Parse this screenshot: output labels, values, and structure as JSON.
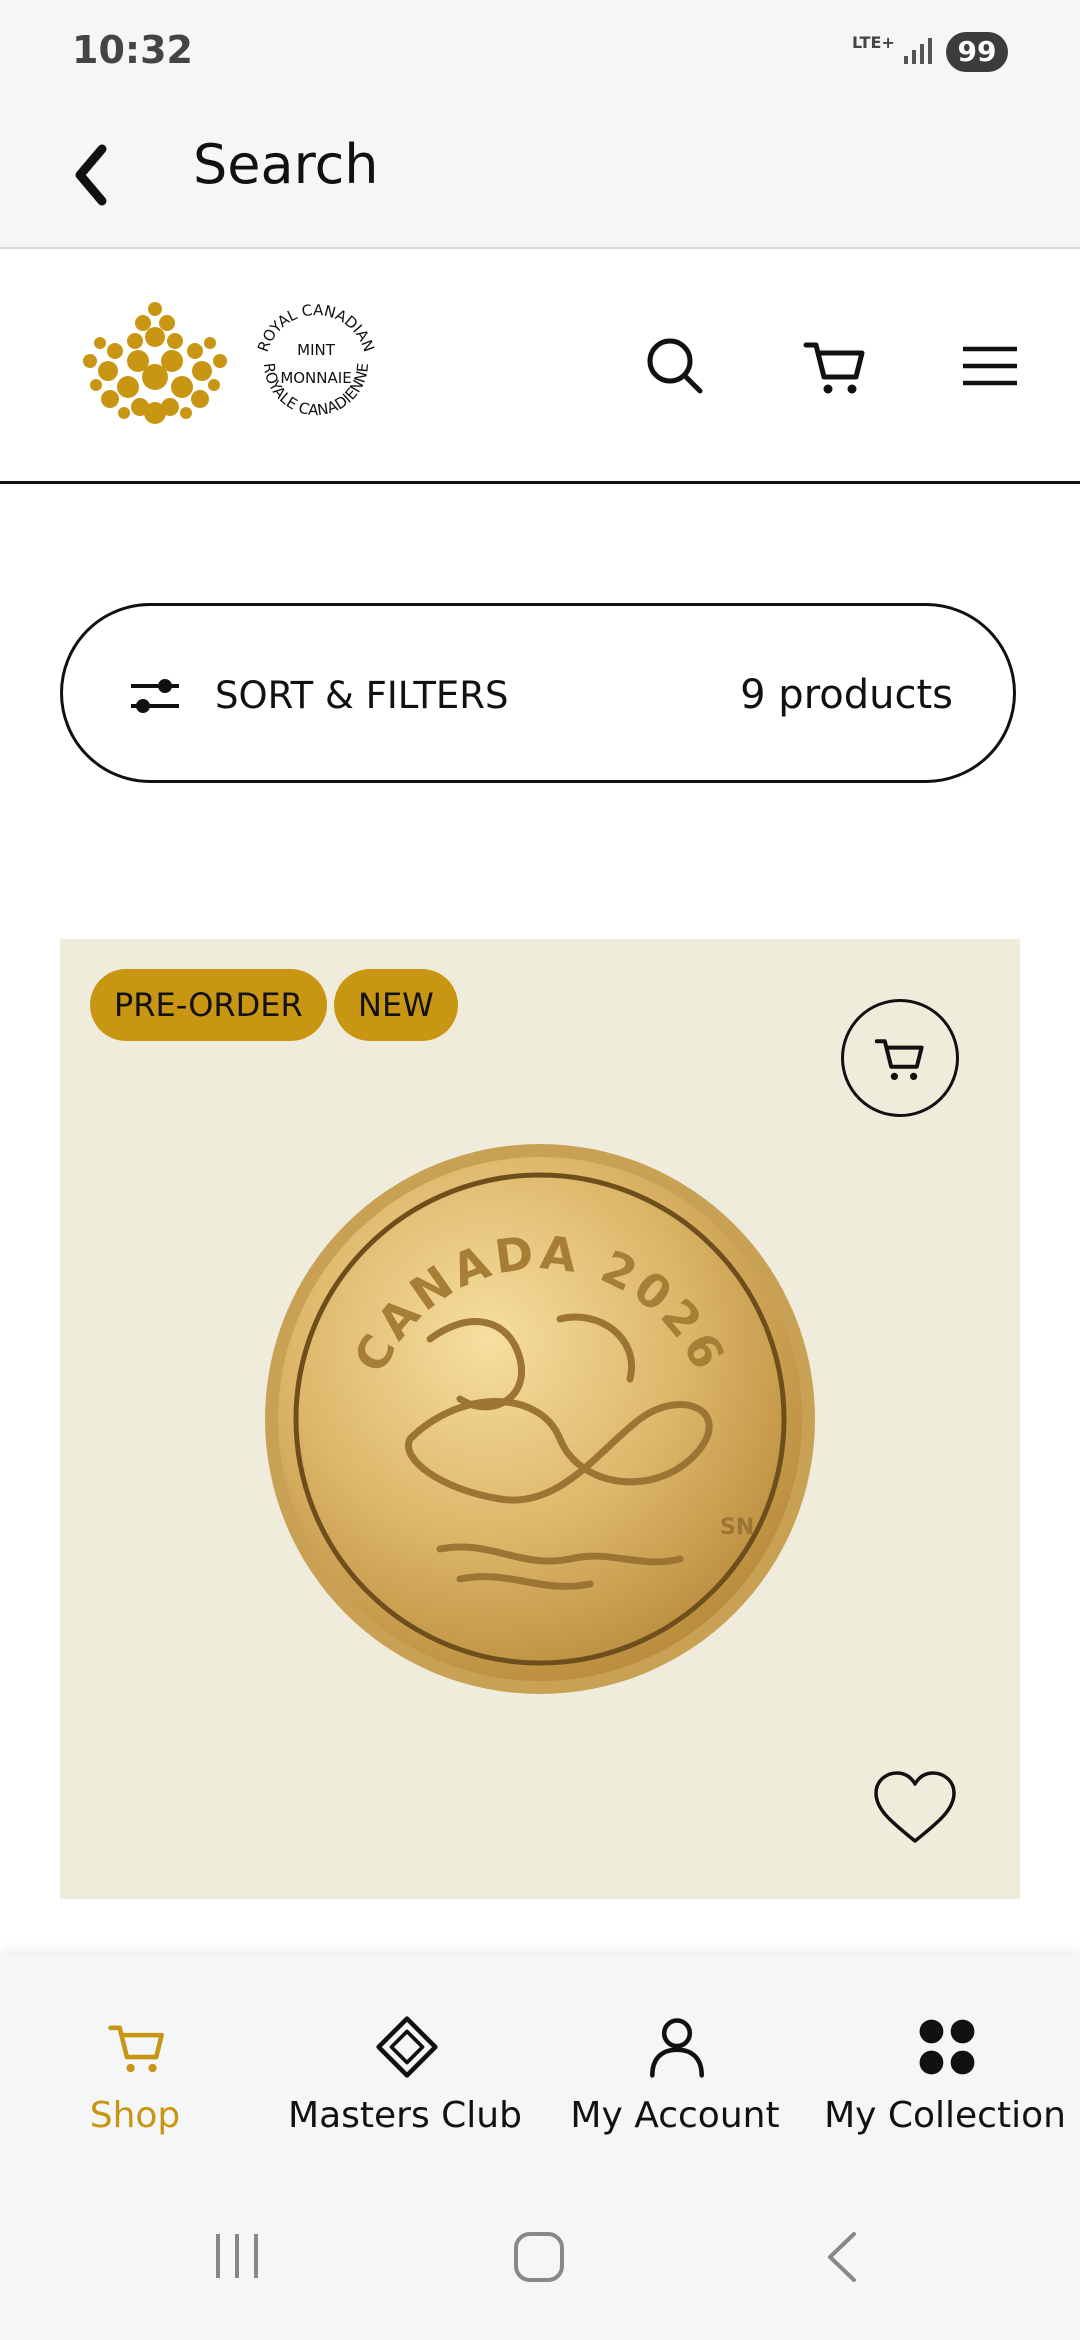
{
  "status": {
    "time": "10:32",
    "network": "LTE+",
    "battery": "99"
  },
  "appbar": {
    "title": "Search"
  },
  "brand": {
    "name": "Royal Canadian Mint",
    "logo_ring_top": "ROYAL CANADIAN",
    "logo_ring_mid1": "MINT",
    "logo_ring_mid2": "MONNAIE",
    "logo_ring_bottom": "ROYALE CANADIENNE"
  },
  "filters": {
    "label": "SORT & FILTERS",
    "count": "9 products"
  },
  "product": {
    "badges": [
      "PRE-ORDER",
      "NEW"
    ],
    "coin_text_top": "CANADA 2026",
    "coin_initials": "SN"
  },
  "bottom_nav": {
    "items": [
      {
        "label": "Shop",
        "icon": "cart-icon",
        "active": true
      },
      {
        "label": "Masters Club",
        "icon": "diamond-icon",
        "active": false
      },
      {
        "label": "My Account",
        "icon": "person-icon",
        "active": false
      },
      {
        "label": "My Collection",
        "icon": "dots-grid-icon",
        "active": false
      }
    ]
  },
  "colors": {
    "accent": "#c99613",
    "card_bg": "#f0ecdc",
    "bar_bg": "#f5f6f8"
  }
}
